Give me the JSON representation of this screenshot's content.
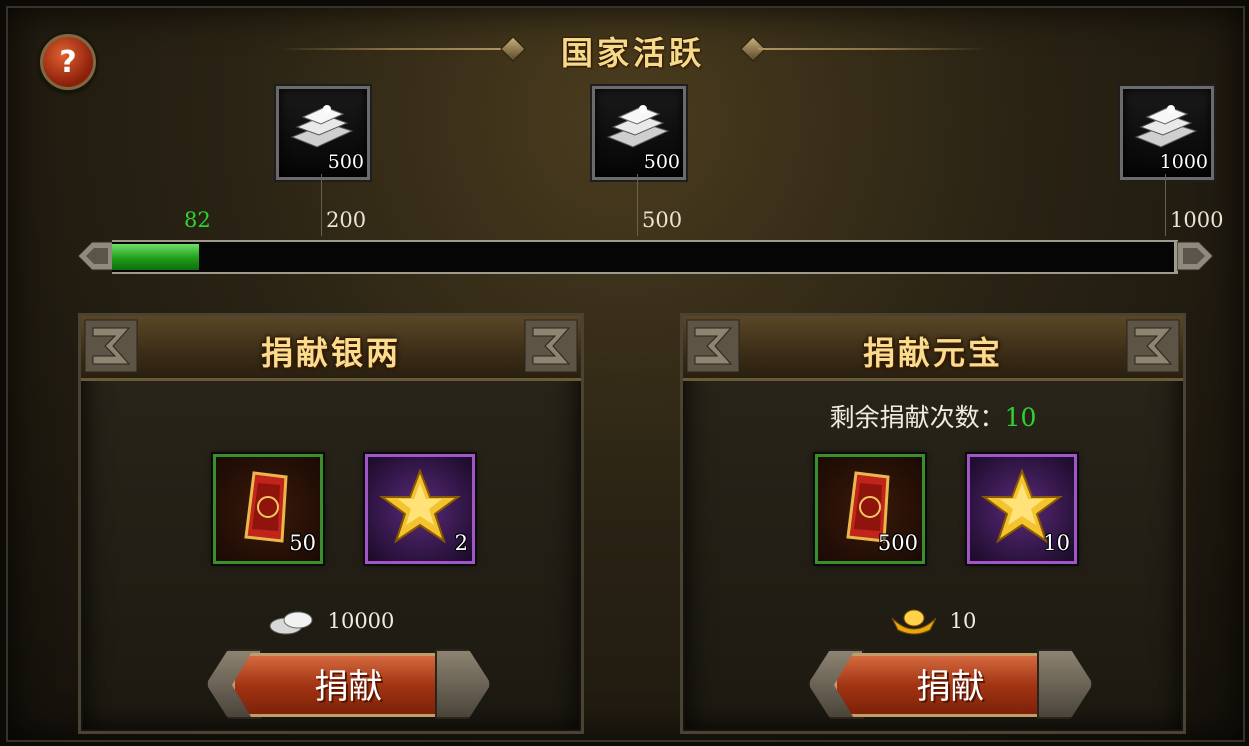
{
  "window": {
    "title": "国家活跃"
  },
  "help": {
    "label": "?"
  },
  "rewards": [
    {
      "qty": "500",
      "icon": "silver-ingot-icon"
    },
    {
      "qty": "500",
      "icon": "silver-ingot-icon"
    },
    {
      "qty": "1000",
      "icon": "silver-ingot-icon"
    }
  ],
  "progress": {
    "current": "82",
    "max": 1000,
    "milestones": [
      "200",
      "500",
      "1000"
    ]
  },
  "silver_panel": {
    "title": "捐献银两",
    "items": [
      {
        "qty": "50",
        "icon": "prestige-token-icon"
      },
      {
        "qty": "2",
        "icon": "activity-star-icon"
      }
    ],
    "cost": "10000",
    "cost_icon": "silver-icon",
    "button": "捐献"
  },
  "gold_panel": {
    "title": "捐献元宝",
    "remaining_label": "剩余捐献次数：",
    "remaining_value": "10",
    "items": [
      {
        "qty": "500",
        "icon": "prestige-token-icon"
      },
      {
        "qty": "10",
        "icon": "activity-star-icon"
      }
    ],
    "cost": "10",
    "cost_icon": "gold-ingot-icon",
    "button": "捐献"
  },
  "colors": {
    "accent_green": "#2fd330",
    "title_gold": "#f7d98a"
  }
}
